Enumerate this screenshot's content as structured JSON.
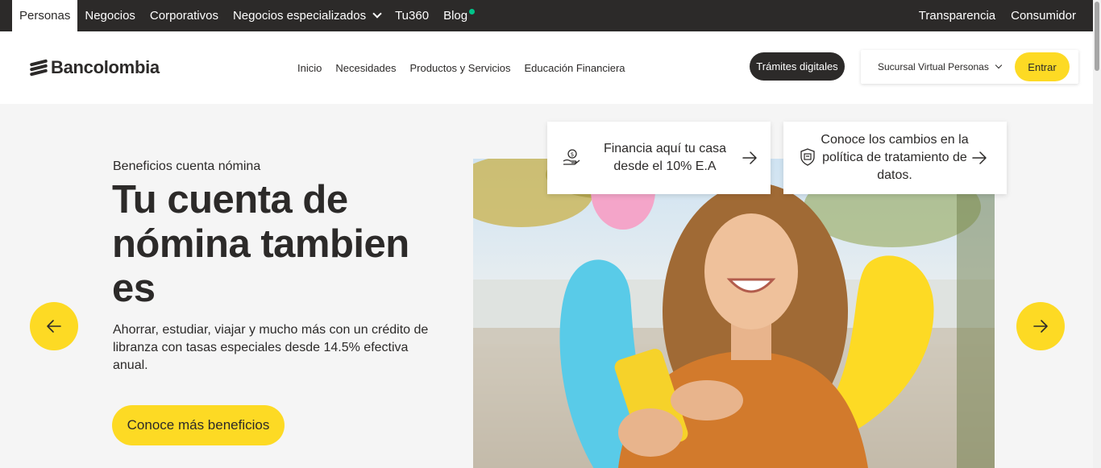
{
  "top_nav": {
    "items": [
      "Personas",
      "Negocios",
      "Corporativos",
      "Negocios especializados",
      "Tu360",
      "Blog"
    ],
    "active": "Personas",
    "right": [
      "Transparencia",
      "Consumidor"
    ],
    "blog_dot_color": "#00c389"
  },
  "header": {
    "logo_text": "Bancolombia",
    "nav": [
      "Inicio",
      "Necesidades",
      "Productos y Servicios",
      "Educación Financiera"
    ],
    "tramites_label": "Trámites digitales",
    "sucursal_label": "Sucursal Virtual Personas",
    "entrar_label": "Entrar"
  },
  "hero": {
    "eyebrow": "Beneficios cuenta nómina",
    "headline": "Tu cuenta de nómina tambien es",
    "description": "Ahorrar, estudiar, viajar y mucho más con un crédito de libranza con tasas especiales desde 14.5% efectiva anual.",
    "cta_label": "Conoce más beneficios"
  },
  "cards": [
    {
      "text": "Financia aquí tu casa desde el 10% E.A",
      "icon": "hand-money-icon"
    },
    {
      "text": "Conoce los cambios en la política de tratamiento de datos.",
      "icon": "data-shield-icon"
    }
  ],
  "colors": {
    "brand_yellow": "#fdda24",
    "dark": "#2c2a29",
    "accent_blue": "#59cbe8",
    "accent_pink": "#f4a5c9"
  }
}
